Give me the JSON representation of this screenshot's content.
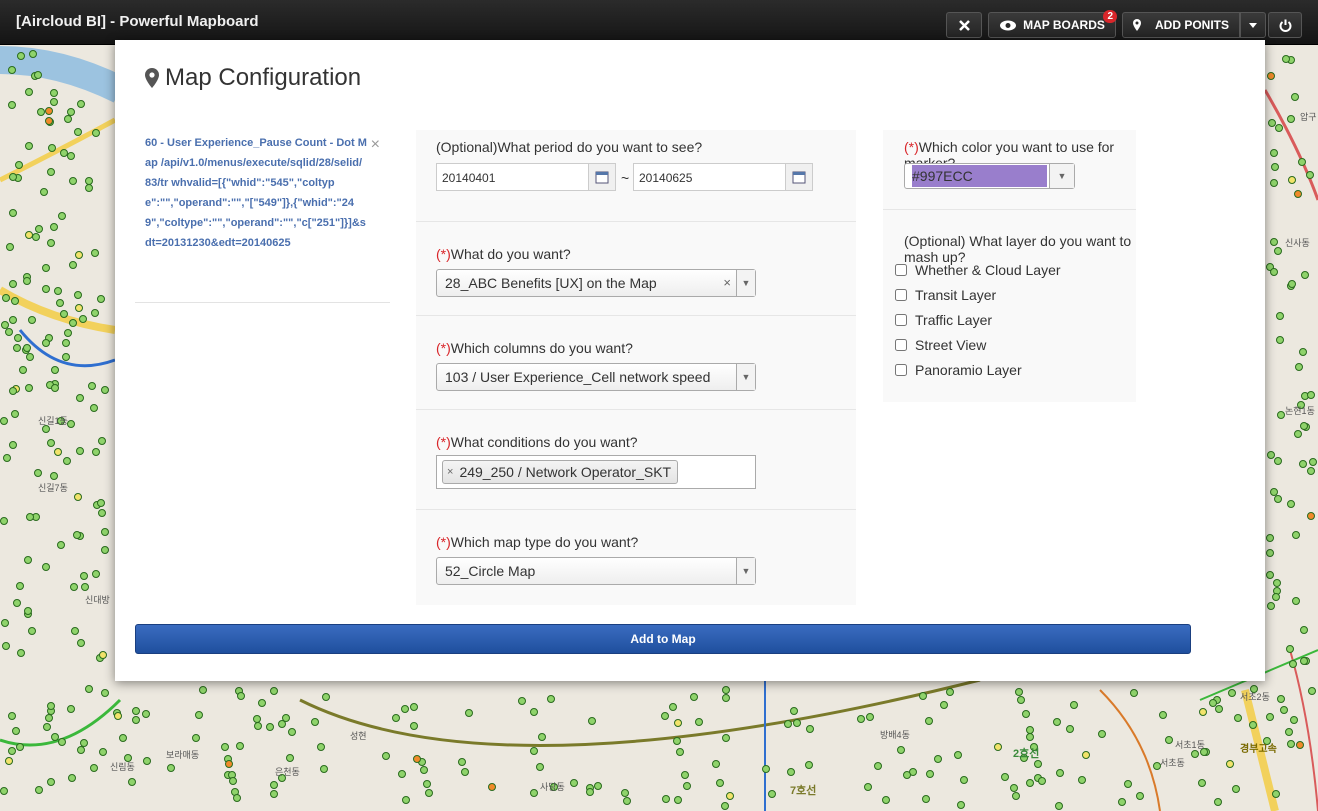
{
  "app": {
    "title": "[Aircloud BI] - Powerful Mapboard"
  },
  "toolbar": {
    "close_icon": "close-icon",
    "map_boards_label": "MAP BOARDS",
    "map_boards_badge": "2",
    "add_points_label": "ADD PONITS",
    "power_icon": "power-icon"
  },
  "map": {
    "labels": [
      "신길1동",
      "신길7동",
      "신대방",
      "보라매동",
      "신림동",
      "은천동",
      "성현",
      "사당동",
      "방배4동",
      "서초2동",
      "서초1동",
      "서초동",
      "논현1동",
      "신사동",
      "압구",
      "7호선",
      "2호선",
      "경부고속"
    ]
  },
  "modal": {
    "title": "Map Configuration",
    "sidebar_item": {
      "text": "60 - User Experience_Pause Count - Dot Map /api/v1.0/menus/execute/sqlid/28/selid/83/tr whvalid=[{\"whid\":\"545\",\"coltype\":\"\",\"operand\":\"\",\"[\"549\"]},{\"whid\":\"249\",\"coltype\":\"\",\"operand\":\"\",\"c[\"251\"]}]&sdt=20131230&edt=20140625",
      "close_label": "×"
    },
    "period": {
      "question": "(Optional)What period do you want to see?",
      "start": "20140401",
      "separator": "~",
      "end": "20140625"
    },
    "what": {
      "req": "(*)",
      "question": "What do you want?",
      "value": "28_ABC Benefits [UX] on the Map",
      "clear": "×"
    },
    "columns": {
      "req": "(*)",
      "question": "Which columns do you want?",
      "value": "103 / User Experience_Cell network speed"
    },
    "conditions": {
      "req": "(*)",
      "question": "What conditions do you want?",
      "tag": "249_250 / Network Operator_SKT",
      "tag_remove": "×"
    },
    "maptype": {
      "req": "(*)",
      "question": "Which map type do you want?",
      "value": "52_Circle Map"
    },
    "color": {
      "req": "(*)",
      "question": "Which color you want to use for marker?",
      "value": "#997ECC"
    },
    "layers": {
      "question": "(Optional) What layer do you want to mash up?",
      "items": [
        {
          "label": "Whether & Cloud Layer",
          "checked": false
        },
        {
          "label": "Transit Layer",
          "checked": false
        },
        {
          "label": "Traffic Layer",
          "checked": false
        },
        {
          "label": "Street View",
          "checked": false
        },
        {
          "label": "Panoramio Layer",
          "checked": false
        }
      ]
    },
    "add_button": "Add to Map"
  }
}
